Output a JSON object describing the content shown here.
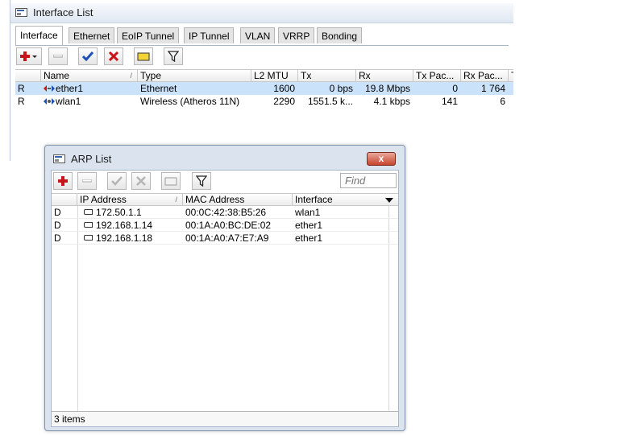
{
  "interface_window": {
    "title": "Interface List",
    "tabs": [
      {
        "label": "Interface",
        "active": true
      },
      {
        "label": "Ethernet",
        "active": false
      },
      {
        "label": "EoIP Tunnel",
        "active": false
      },
      {
        "label": "IP Tunnel",
        "active": false
      },
      {
        "label": "VLAN",
        "active": false
      },
      {
        "label": "VRRP",
        "active": false
      },
      {
        "label": "Bonding",
        "active": false
      }
    ],
    "toolbar": [
      "add-icon",
      "remove-icon",
      "enable-check-icon",
      "disable-x-icon",
      "comment-icon",
      "filter-icon"
    ],
    "columns": [
      "Name",
      "Type",
      "L2 MTU",
      "Tx",
      "Rx",
      "Tx Pac...",
      "Rx Pac...",
      "T"
    ],
    "rows": [
      {
        "flag": "R",
        "name": "ether1",
        "type": "Ethernet",
        "l2mtu": "1600",
        "tx": "0 bps",
        "rx": "19.8 Mbps",
        "tx_packets": "0",
        "rx_packets": "1 764",
        "selected": true
      },
      {
        "flag": "R",
        "name": "wlan1",
        "type": "Wireless (Atheros 11N)",
        "l2mtu": "2290",
        "tx": "1551.5 k...",
        "rx": "4.1 kbps",
        "tx_packets": "141",
        "rx_packets": "6",
        "selected": false
      }
    ]
  },
  "arp_window": {
    "title": "ARP List",
    "close_label": "x",
    "find_placeholder": "Find",
    "columns": [
      "IP Address",
      "MAC Address",
      "Interface"
    ],
    "rows": [
      {
        "flag": "D",
        "ip": "172.50.1.1",
        "mac": "00:0C:42:38:B5:26",
        "interface": "wlan1"
      },
      {
        "flag": "D",
        "ip": "192.168.1.14",
        "mac": "00:1A:A0:BC:DE:02",
        "interface": "ether1"
      },
      {
        "flag": "D",
        "ip": "192.168.1.18",
        "mac": "00:1A:A0:A7:E7:A9",
        "interface": "ether1"
      }
    ],
    "status": "3 items"
  },
  "colors": {
    "selected_row": "#cbe2fb",
    "add_red": "#c8151a",
    "check_blue": "#1f4fb5",
    "close_red": "#c9442d"
  }
}
